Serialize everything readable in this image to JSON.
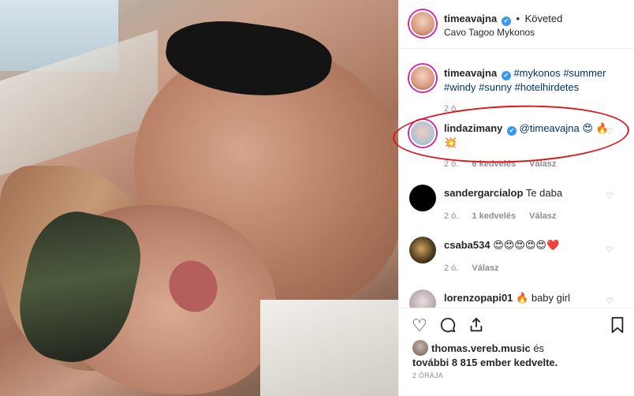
{
  "header": {
    "username": "timeavajna",
    "verified_mark": "✔",
    "dot": "•",
    "follow_status": "Követed",
    "location": "Cavo Tagoo Mykonos"
  },
  "caption": {
    "username": "timeavajna",
    "text": "#mykonos #summer #windy #sunny #hotelhirdetes",
    "time": "2 ó."
  },
  "comments": [
    {
      "username": "lindazimany",
      "text": "@timeavajna 😍 🔥💥",
      "time": "2 ó.",
      "likes": "6 kedvelés",
      "reply": "Válasz",
      "highlighted": true
    },
    {
      "username": "sandergarcialop",
      "text": "Te daba",
      "time": "2 ó.",
      "likes": "1 kedvelés",
      "reply": "Válasz"
    },
    {
      "username": "csaba534",
      "text": "😍😍😍😍😍❤️",
      "time": "2 ó.",
      "reply": "Válasz"
    },
    {
      "username": "lorenzopapi01",
      "text": "🔥 baby girl"
    }
  ],
  "actions": {
    "like_icon": "heart-icon",
    "comment_icon": "comment-icon",
    "share_icon": "share-icon",
    "save_icon": "bookmark-icon"
  },
  "likes": {
    "first_user": "thomas.vereb.music",
    "text_mid": " és",
    "text_rest": "további 8 815 ember kedvelte."
  },
  "post_time": "2 ÓRÁJA",
  "colors": {
    "accent_link": "#003569",
    "verified": "#3897f0",
    "highlight_ring": "#d8181c"
  }
}
